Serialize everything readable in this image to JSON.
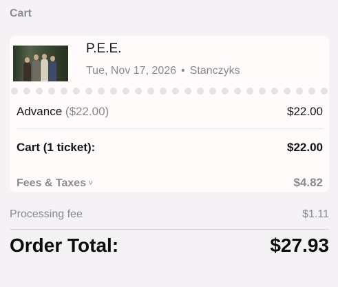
{
  "cart": {
    "title": "Cart"
  },
  "event": {
    "name": "P.E.E.",
    "date": "Tue, Nov 17, 2026",
    "separator": "•",
    "venue": "Stanczyks",
    "thumbnail_icon": "band-photo"
  },
  "line_items": {
    "advance_label": "Advance",
    "advance_face_value": "($22.00)",
    "advance_amount": "$22.00"
  },
  "subtotal": {
    "label": "Cart (1 ticket):",
    "amount": "$22.00"
  },
  "fees": {
    "label": "Fees & Taxes",
    "chevron": "˅",
    "amount": "$4.82"
  },
  "processing": {
    "label": "Processing fee",
    "amount": "$1.11"
  },
  "order_total": {
    "label": "Order Total:",
    "amount": "$27.93"
  },
  "colors": {
    "background": "#f4f2f5",
    "card": "#fffbfa",
    "muted_text": "#8a8891",
    "heading_muted": "#8d8a94",
    "primary_text": "#141414"
  }
}
